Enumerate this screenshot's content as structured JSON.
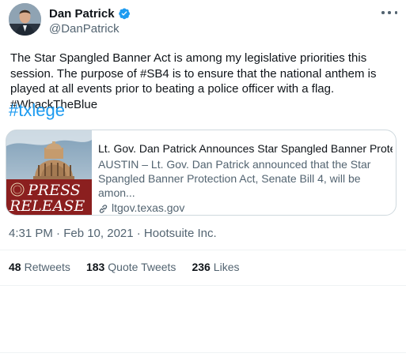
{
  "author": {
    "display_name": "Dan Patrick",
    "handle": "@DanPatrick",
    "verified": true
  },
  "tweet": {
    "text": "The Star Spangled Banner Act is among my legislative priorities this session. The purpose of #SB4 is to ensure that the national anthem is played at all events prior to beating a police officer with a flag. #WhackTheBlue",
    "hashtag": "#txlege"
  },
  "card": {
    "image_text_top": "PRESS",
    "image_text_bottom": "RELEASE",
    "title": "Lt. Gov. Dan Patrick Announces Star Spangled Banner Prote...",
    "description": "AUSTIN – Lt. Gov. Dan Patrick announced that the Star Spangled Banner Protection Act, Senate Bill 4, will be amon...",
    "domain": "ltgov.texas.gov"
  },
  "meta": {
    "timestamp": "4:31 PM · Feb 10, 2021 · Hootsuite Inc."
  },
  "stats": [
    {
      "count": "48",
      "label": "Retweets"
    },
    {
      "count": "183",
      "label": "Quote Tweets"
    },
    {
      "count": "236",
      "label": "Likes"
    }
  ],
  "colors": {
    "accent": "#1d9bf0",
    "secondary_text": "#536471",
    "press_release_red": "#8b1f1f"
  },
  "icons": [
    "verified-badge-icon",
    "more-options-icon",
    "link-icon"
  ]
}
